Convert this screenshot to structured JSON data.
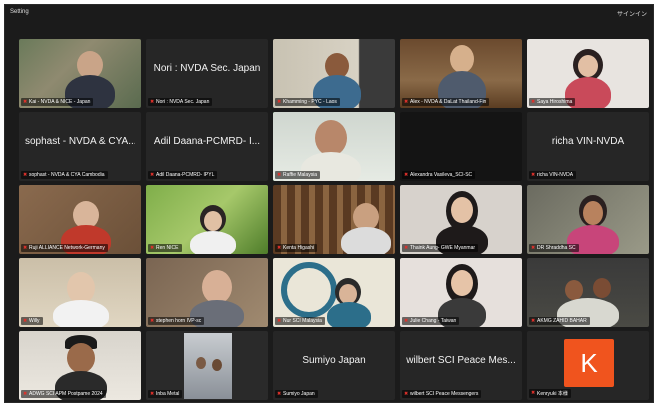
{
  "window": {
    "title_left": "Setting",
    "title_right": "サインイン"
  },
  "participants": [
    {
      "label": "Kai - NVDA & NICE - Japan",
      "display": "",
      "video": true
    },
    {
      "label": "Nori : NVDA Sec. Japan",
      "display": "Nori : NVDA Sec. Japan",
      "video": false
    },
    {
      "label": "Khamming - PYC - Laos",
      "display": "",
      "video": true
    },
    {
      "label": "Alex - NVDA & DaLat Thailand-Fin",
      "display": "",
      "video": true
    },
    {
      "label": "Saya Hiroshima",
      "display": "",
      "video": true
    },
    {
      "label": "sophast - NVDA & CYA Cambodia",
      "display": "sophast - NVDA & CYA...",
      "video": false
    },
    {
      "label": "Adil Daana-PCMRD- IPYL",
      "display": "Adil Daana-PCMRD- I...",
      "video": false
    },
    {
      "label": "Raffie Malaysia",
      "display": "",
      "video": true,
      "speaking": true
    },
    {
      "label": "Alexandra Vasileva_SCI-SC",
      "display": "",
      "video": true
    },
    {
      "label": "richa VIN-NVDA",
      "display": "richa VIN-NVDA",
      "video": false
    },
    {
      "label": "Ruji ALLIANCE Network-Germany",
      "display": "",
      "video": true
    },
    {
      "label": "Ren NICE",
      "display": "",
      "video": true
    },
    {
      "label": "Kenta Higashi",
      "display": "",
      "video": true
    },
    {
      "label": "Thaink Aung- GWE Myanmar",
      "display": "",
      "video": true
    },
    {
      "label": "DR Shraddha SC",
      "display": "",
      "video": true
    },
    {
      "label": "Willy",
      "display": "",
      "video": true
    },
    {
      "label": "stephen horn IVP-sc",
      "display": "",
      "video": true
    },
    {
      "label": "Nur SCI Malaysia",
      "display": "",
      "video": true
    },
    {
      "label": "Julie Chang - Taiwan",
      "display": "",
      "video": true
    },
    {
      "label": "AKMG ZAHID BAHAR",
      "display": "",
      "video": true
    },
    {
      "label": "ADWG SCI APM Postpame 2024",
      "display": "",
      "video": true
    },
    {
      "label": "Inba Metal",
      "display": "",
      "video": true
    },
    {
      "label": "Sumiyo Japan",
      "display": "Sumiyo Japan",
      "video": false
    },
    {
      "label": "wilbert SCI Peace Messengers",
      "display": "wilbert SCI Peace Mes...",
      "video": false
    },
    {
      "label": "Kenryuki 本様",
      "display": "",
      "video": false,
      "avatar": "K"
    }
  ],
  "colors": {
    "window_bg": "#1b1b1b",
    "tile_bg": "#262626",
    "active_speaker": "#3fbf5a",
    "muted_icon": "#e0312b",
    "avatar_bg": "#f0541e"
  },
  "icons": [
    "muted-mic-icon"
  ]
}
